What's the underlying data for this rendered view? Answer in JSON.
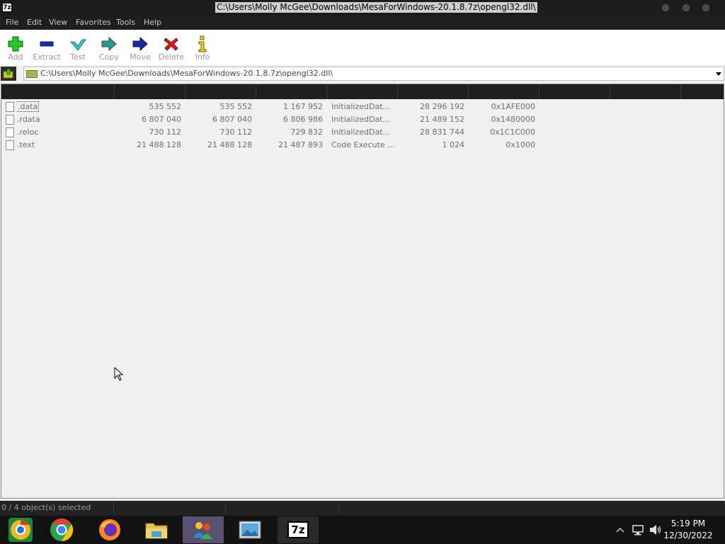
{
  "window": {
    "app_icon_text": "7z",
    "title": "C:\\Users\\Molly McGee\\Downloads\\MesaForWindows-20.1.8.7z\\opengl32.dll\\"
  },
  "menu": [
    "File",
    "Edit",
    "View",
    "Favorites",
    "Tools",
    "Help"
  ],
  "toolbar": {
    "add": "Add",
    "extract": "Extract",
    "test": "Test",
    "copy": "Copy",
    "move": "Move",
    "delete": "Delete",
    "info": "Info"
  },
  "address": {
    "path": "C:\\Users\\Molly McGee\\Downloads\\MesaForWindows-20.1.8.7z\\opengl32.dll\\"
  },
  "files": [
    {
      "name": ".data",
      "size": "535 552",
      "packed": "535 552",
      "virtual_size": "1 167 952",
      "characteristics": "InitializedDat...",
      "offset": "28 296 192",
      "va": "0x1AFE000"
    },
    {
      "name": ".rdata",
      "size": "6 807 040",
      "packed": "6 807 040",
      "virtual_size": "6 806 986",
      "characteristics": "InitializedDat...",
      "offset": "21 489 152",
      "va": "0x1480000"
    },
    {
      "name": ".reloc",
      "size": "730 112",
      "packed": "730 112",
      "virtual_size": "729 832",
      "characteristics": "InitializedDat...",
      "offset": "28 831 744",
      "va": "0x1C1C000"
    },
    {
      "name": ".text",
      "size": "21 488 128",
      "packed": "21 488 128",
      "virtual_size": "21 487 893",
      "characteristics": "Code Execute ...",
      "offset": "1 024",
      "va": "0x1000"
    }
  ],
  "status": {
    "selection": "0 / 4 object(s) selected"
  },
  "taskbar": {
    "apps": [
      "chrome-icon",
      "chrome-icon",
      "firefox-icon",
      "file-explorer-icon",
      "people-icon",
      "photo-viewer-icon",
      "7zip-icon"
    ],
    "seven_zip_label": "7z",
    "time": "5:19 PM",
    "date": "12/30/2022"
  }
}
